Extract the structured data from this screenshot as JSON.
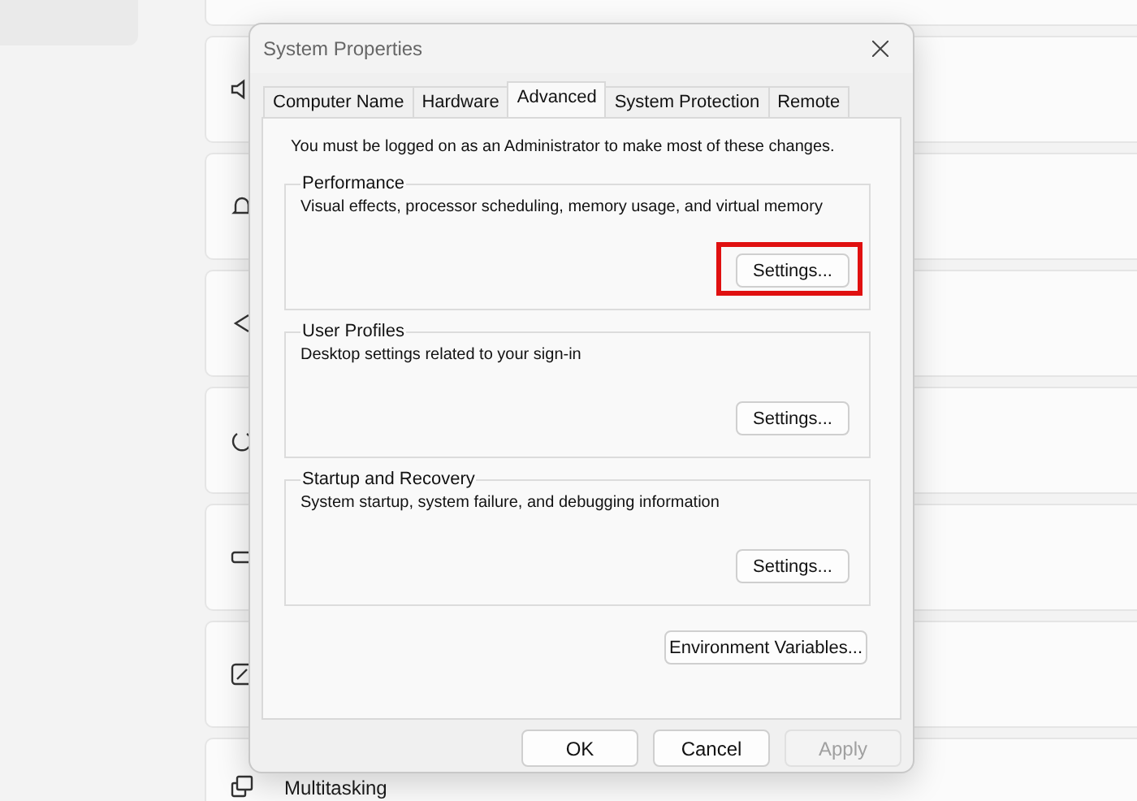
{
  "background": {
    "card_title": "Multitasking"
  },
  "dialog": {
    "title": "System Properties",
    "tabs": [
      {
        "label": "Computer Name",
        "selected": false
      },
      {
        "label": "Hardware",
        "selected": false
      },
      {
        "label": "Advanced",
        "selected": true
      },
      {
        "label": "System Protection",
        "selected": false
      },
      {
        "label": "Remote",
        "selected": false
      }
    ],
    "notice": "You must be logged on as an Administrator to make most of these changes.",
    "groups": [
      {
        "title": "Performance",
        "description": "Visual effects, processor scheduling, memory usage, and virtual memory",
        "button": {
          "label": "Settings...",
          "highlighted": true
        }
      },
      {
        "title": "User Profiles",
        "description": "Desktop settings related to your sign-in",
        "button": {
          "label": "Settings...",
          "highlighted": false
        }
      },
      {
        "title": "Startup and Recovery",
        "description": "System startup, system failure, and debugging information",
        "button": {
          "label": "Settings...",
          "highlighted": false
        }
      }
    ],
    "environment_button": "Environment Variables...",
    "buttons": [
      {
        "label": "OK",
        "disabled": false
      },
      {
        "label": "Cancel",
        "disabled": false
      },
      {
        "label": "Apply",
        "disabled": true
      }
    ]
  }
}
